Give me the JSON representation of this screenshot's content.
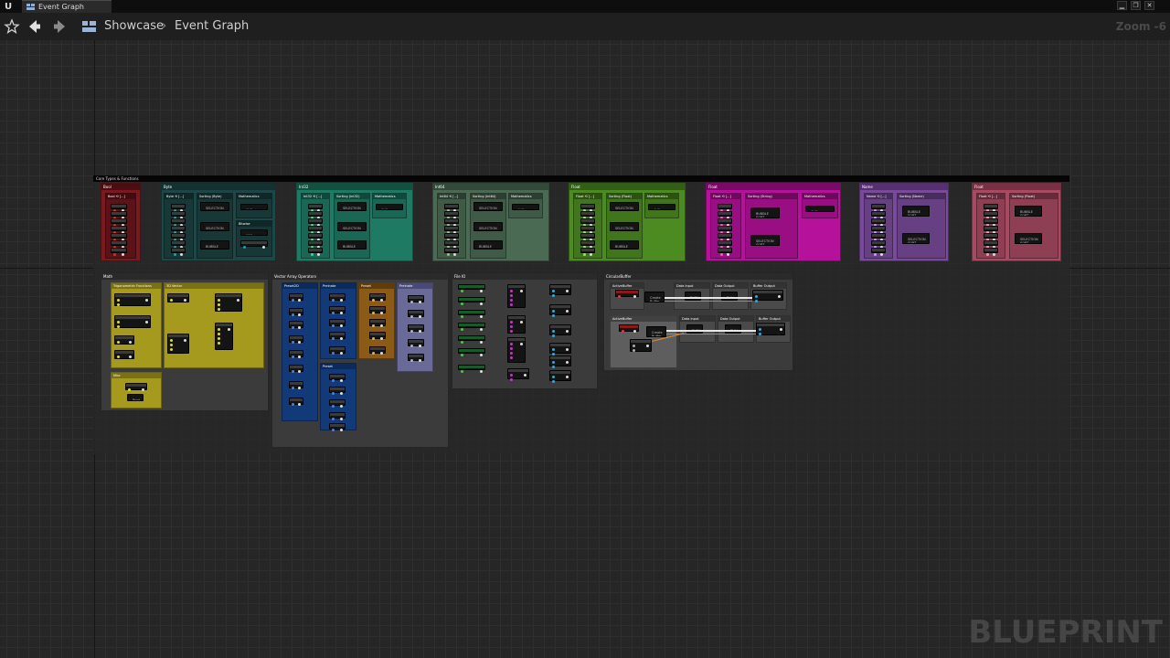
{
  "tab": {
    "title": "Event Graph"
  },
  "breadcrumb": {
    "root": "Showcase",
    "separator": "›",
    "current": "Event Graph"
  },
  "toolbar": {
    "zoom": "Zoom -6"
  },
  "graph": {
    "main_comment": "Core Types & Functions",
    "watermark": "BLUEPRINT",
    "colors": {
      "bool": "#7a1a1f",
      "byte": "#1f4646",
      "int32": "#1f7a64",
      "int64": "#4a6a54",
      "float": "#4c8a22",
      "string": "#b5119a",
      "name": "#7a4a9a",
      "text": "#a84a62",
      "misc": "#3b3b3b",
      "yellow": "#a69a1e",
      "blue": "#123a78",
      "orange": "#8a5a16",
      "lavender": "#6a6a98"
    },
    "groups": [
      {
        "id": "bool",
        "title": "Bool",
        "subs": [
          {
            "title": "Bool ⟲ [...]"
          }
        ]
      },
      {
        "id": "byte",
        "title": "Byte",
        "subs": [
          {
            "title": "Byte ⟲ [...]"
          },
          {
            "title": "Sorting (Byte)"
          },
          {
            "title": "Mathematics"
          },
          {
            "title": "Bitwise"
          }
        ]
      },
      {
        "id": "int32",
        "title": "Int32",
        "subs": [
          {
            "title": "Int32 ⟲ [...]"
          },
          {
            "title": "Sorting (Int32)"
          },
          {
            "title": "Mathematics"
          }
        ]
      },
      {
        "id": "int64",
        "title": "Int64",
        "subs": [
          {
            "title": "Int64 ⟲ [...]"
          },
          {
            "title": "Sorting (Int64)"
          },
          {
            "title": "Mathematics"
          }
        ]
      },
      {
        "id": "float",
        "title": "Float",
        "subs": [
          {
            "title": "Float ⟲ [...]"
          },
          {
            "title": "Sorting (Float)"
          },
          {
            "title": "Mathematics"
          }
        ]
      },
      {
        "id": "string",
        "title": "Float",
        "subs": [
          {
            "title": "Float ⟲ [...]"
          },
          {
            "title": "Sorting (String)"
          },
          {
            "title": "Mathematics"
          }
        ]
      },
      {
        "id": "name",
        "title": "Name",
        "subs": [
          {
            "title": "Name ⟲ [...]"
          },
          {
            "title": "Sorting (Name)"
          }
        ]
      },
      {
        "id": "text",
        "title": "Float",
        "subs": [
          {
            "title": "Float ⟲ [...]"
          },
          {
            "title": "Sorting (Float)"
          }
        ]
      },
      {
        "id": "math",
        "title": "Math",
        "subs": [
          {
            "title": "Trigonometric Functions"
          },
          {
            "title": "3D Vector"
          },
          {
            "title": "Misc"
          }
        ]
      },
      {
        "id": "vector",
        "title": "Vector Array Operators",
        "subs": [
          {
            "title": "Preset2D"
          },
          {
            "title": "Preinate"
          },
          {
            "title": "Preset"
          },
          {
            "title": "Preset"
          },
          {
            "title": "Preinate"
          }
        ]
      },
      {
        "id": "fileio",
        "title": "File IO",
        "subs": []
      },
      {
        "id": "circular",
        "title": "CircularBuffer",
        "subs": [
          {
            "title": "ActiveBuffer"
          },
          {
            "title": "Data Input"
          },
          {
            "title": "Data Output"
          },
          {
            "title": "Buffer Output"
          },
          {
            "title": "ActiveBuffer"
          },
          {
            "title": "Data Input"
          },
          {
            "title": "Data Output"
          },
          {
            "title": "Buffer Output"
          }
        ]
      }
    ],
    "node_labels": {
      "selection_sort": "SELECTION SORT",
      "bubble_sort": "BUBBLE SORT",
      "avg": "AVG",
      "xor": "XOR",
      "push": "PUSH",
      "pull": "PULL",
      "create_buffer": "Create Buffer",
      "print": "Print"
    }
  }
}
